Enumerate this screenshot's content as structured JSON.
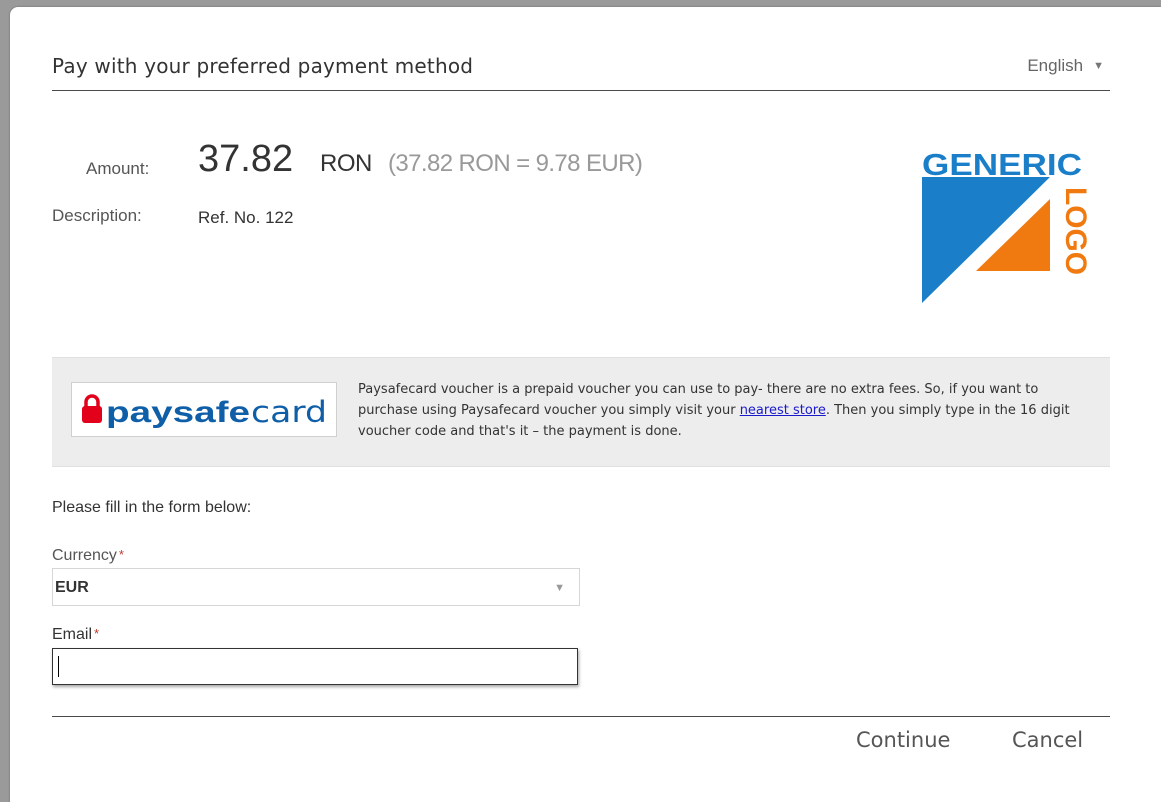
{
  "header": {
    "title": "Pay with your preferred payment method",
    "language": "English"
  },
  "summary": {
    "amount_label": "Amount:",
    "amount_value": "37.82",
    "amount_currency": "RON",
    "amount_conversion": "(37.82 RON = 9.78 EUR)",
    "description_label": "Description:",
    "description_value": "Ref. No. 122"
  },
  "merchant_logo": {
    "text_top": "GENERIC",
    "text_side": "LOGO",
    "colors": {
      "blue": "#1a7fc8",
      "orange": "#f07a10"
    }
  },
  "payment_method": {
    "logo_text_bold": "paysafe",
    "logo_text_light": "card",
    "description_before_link": "Paysafecard voucher is a prepaid voucher you can use to pay- there are no extra fees. So, if you want to purchase using Paysafecard voucher you simply visit your ",
    "link_text": "nearest store",
    "description_after_link": ". Then you simply type in the 16 digit voucher code and that's it – the payment is done.",
    "colors": {
      "red": "#e2001a",
      "blue": "#0f5ea8"
    }
  },
  "form": {
    "intro": "Please fill in the form below:",
    "currency_label": "Currency",
    "currency_value": "EUR",
    "email_label": "Email",
    "email_value": "",
    "required_mark": "*"
  },
  "footer": {
    "continue_label": "Continue",
    "cancel_label": "Cancel"
  }
}
